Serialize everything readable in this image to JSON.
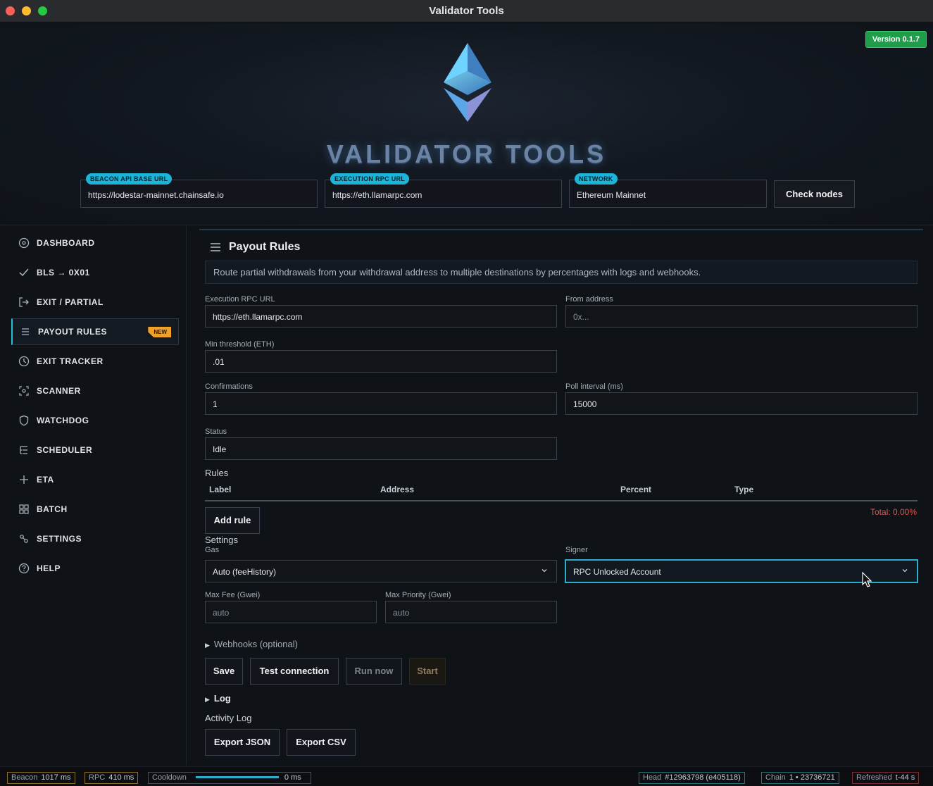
{
  "window": {
    "title": "Validator Tools"
  },
  "header": {
    "version": "Version 0.1.7",
    "brand": "VALIDATOR TOOLS",
    "beacon": {
      "tag": "BEACON API BASE URL",
      "value": "https://lodestar-mainnet.chainsafe.io"
    },
    "execution": {
      "tag": "EXECUTION RPC URL",
      "value": "https://eth.llamarpc.com"
    },
    "network": {
      "tag": "NETWORK",
      "value": "Ethereum Mainnet"
    },
    "check_nodes": "Check nodes"
  },
  "sidebar": {
    "items": [
      {
        "label": "DASHBOARD",
        "icon": "dashboard-icon"
      },
      {
        "label": "BLS → 0X01",
        "icon": "check-icon"
      },
      {
        "label": "EXIT / PARTIAL",
        "icon": "exit-icon"
      },
      {
        "label": "PAYOUT RULES",
        "icon": "list-icon",
        "badge": "NEW"
      },
      {
        "label": "EXIT TRACKER",
        "icon": "clock-icon"
      },
      {
        "label": "SCANNER",
        "icon": "scanner-icon"
      },
      {
        "label": "WATCHDOG",
        "icon": "shield-icon"
      },
      {
        "label": "SCHEDULER",
        "icon": "scheduler-icon"
      },
      {
        "label": "ETA",
        "icon": "plus-icon"
      },
      {
        "label": "BATCH",
        "icon": "grid-icon"
      },
      {
        "label": "SETTINGS",
        "icon": "settings-icon"
      },
      {
        "label": "HELP",
        "icon": "help-icon"
      }
    ]
  },
  "panel": {
    "title": "Payout Rules",
    "description": "Route partial withdrawals from your withdrawal address to multiple destinations by percentages with logs and webhooks.",
    "fields": {
      "exec_rpc": {
        "label": "Execution RPC URL",
        "value": "https://eth.llamarpc.com"
      },
      "from": {
        "label": "From address",
        "placeholder": "0x..."
      },
      "min_threshold": {
        "label": "Min threshold (ETH)",
        "value": ".01"
      },
      "confirmations": {
        "label": "Confirmations",
        "value": "1"
      },
      "poll": {
        "label": "Poll interval (ms)",
        "value": "15000"
      },
      "status": {
        "label": "Status",
        "value": "Idle"
      }
    },
    "rules": {
      "title": "Rules",
      "columns": [
        "Label",
        "Address",
        "Percent",
        "Type"
      ],
      "add_rule": "Add rule",
      "total": "Total: 0.00%"
    },
    "settings": {
      "title": "Settings",
      "gas_label": "Gas",
      "gas_value": "Auto (feeHistory)",
      "signer_label": "Signer",
      "signer_value": "RPC Unlocked Account",
      "max_fee_label": "Max Fee (Gwei)",
      "max_fee_placeholder": "auto",
      "max_priority_label": "Max Priority (Gwei)",
      "max_priority_placeholder": "auto"
    },
    "webhooks": "Webhooks (optional)",
    "actions": {
      "save": "Save",
      "test": "Test connection",
      "run": "Run now",
      "start": "Start"
    },
    "log": "Log",
    "activity": {
      "title": "Activity Log",
      "export_json": "Export JSON",
      "export_csv": "Export CSV"
    }
  },
  "statusbar": {
    "beacon": {
      "k": "Beacon",
      "v": "1017 ms"
    },
    "rpc": {
      "k": "RPC",
      "v": "410 ms"
    },
    "cooldown": {
      "k": "Cooldown",
      "v": "0 ms"
    },
    "head": {
      "k": "Head",
      "v": "#12963798 (e405118)"
    },
    "chain": {
      "k": "Chain",
      "v": "1 • 23736721"
    },
    "refreshed": {
      "k": "Refreshed",
      "v": "t-44 s"
    }
  },
  "colors": {
    "accent": "#23c0d8",
    "badge": "#f0a12a",
    "version": "#1f9d4a",
    "error": "#e2554e"
  }
}
